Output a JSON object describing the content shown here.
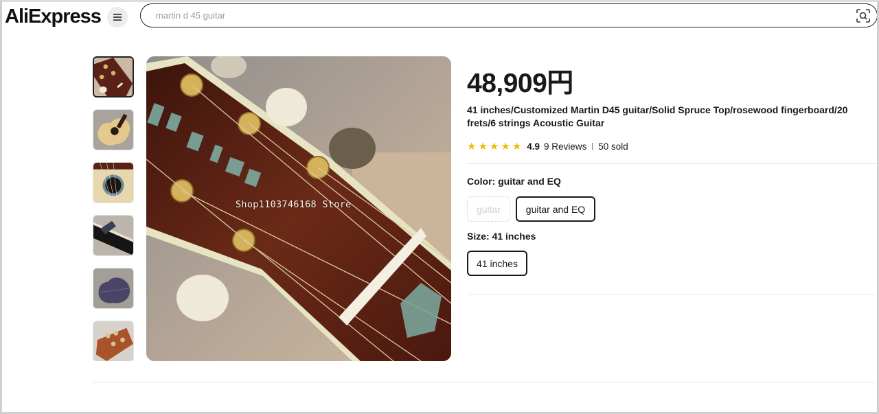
{
  "header": {
    "logo_text": "AliExpress",
    "search_placeholder": "martin d 45 guitar"
  },
  "product": {
    "price": "48,909円",
    "title": "41 inches/Customized Martin D45 guitar/Solid Spruce Top/rosewood fingerboard/20 frets/6 strings Acoustic Guitar",
    "rating": {
      "stars": 5,
      "score": "4.9",
      "reviews": "9 Reviews",
      "separator": "|",
      "sold": "50 sold"
    },
    "color": {
      "label": "Color: ",
      "value": "guitar and EQ",
      "options": [
        "guitar",
        "guitar and EQ"
      ]
    },
    "size": {
      "label": "Size: ",
      "value": "41 inches",
      "options": [
        "41 inches"
      ]
    },
    "image_watermark": "Shop1103746168 Store"
  },
  "colors": {
    "star": "#f2b806",
    "text": "#191919",
    "rosewood": "#5a2216"
  }
}
